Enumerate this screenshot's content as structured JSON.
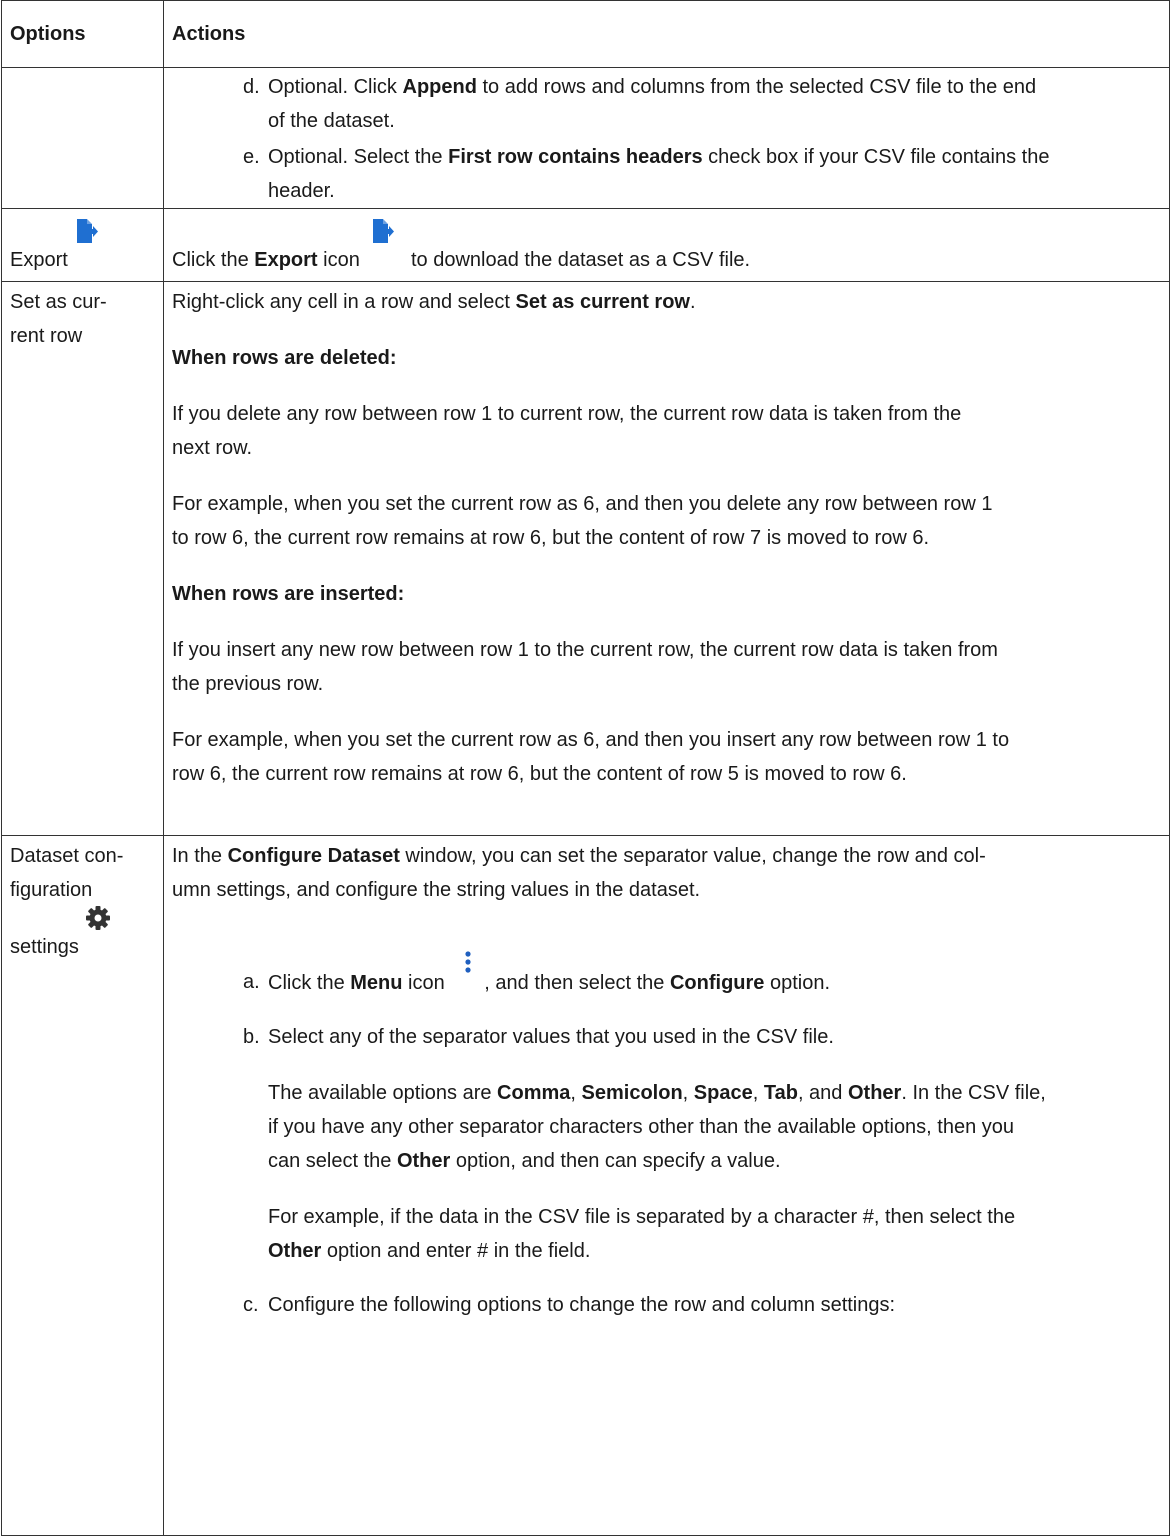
{
  "table": {
    "headers": [
      "Options",
      "Actions"
    ]
  },
  "row_import": {
    "steps": [
      {
        "label": "d.",
        "t1": "Optional. Click ",
        "b1": "Append",
        "line1_rest": " to add rows and columns from the selected CSV file to the end",
        "line2": "of the dataset."
      },
      {
        "label": "e.",
        "t1": "Optional. Select the ",
        "b1": "First row contains headers",
        "line1_rest": " check box if your CSV file contains the",
        "line2": "header."
      }
    ]
  },
  "row_export": {
    "option": "Export",
    "t1": "Click the ",
    "b1": "Export",
    "t2": " icon",
    "t3": "to download the dataset as a CSV file."
  },
  "row_current": {
    "option_line1": "Set as cur-",
    "option_line2": "rent row",
    "p1_text": "Right-click any cell in a row and select ",
    "p1_bold": "Set as current row",
    "p1_end": ".",
    "h1": "When rows are deleted:",
    "p2_l1": "If you delete any row between row 1 to current row, the current row data is taken from the",
    "p2_l2": "next row.",
    "p3_l1": "For example, when you set the current row as 6, and then you delete any row between row 1",
    "p3_l2": "to row 6, the current row remains at row 6, but the content of row 7 is moved to row 6.",
    "h2": "When rows are inserted:",
    "p4_l1": "If you insert any new row between row 1 to the current row, the current row data is taken from",
    "p4_l2": "the previous row.",
    "p5_l1": "For example, when you set the current row as 6, and then you insert any row between row 1 to",
    "p5_l2": "row 6, the current row remains at row 6, but the content of row 5 is moved to row 6."
  },
  "row_config": {
    "option_line1": "Dataset con-",
    "option_line2": "figuration",
    "option_line3": "settings",
    "intro_t1": "In the ",
    "intro_b1": "Configure Dataset",
    "intro_l1_rest": " window, you can set the separator value, change the row and col-",
    "intro_l2": "umn settings, and configure the string values in the dataset.",
    "step_a": {
      "label": "a.",
      "t1": "Click the ",
      "b1": "Menu",
      "t2": " icon",
      "t3": ", and then select the ",
      "b2": "Configure",
      "t4": " option."
    },
    "step_b": {
      "label": "b.",
      "text": "Select any of the separator values that you used in the CSV file.",
      "p1_t1": "The available options are ",
      "p1_b1": "Comma",
      "p1_s1": ", ",
      "p1_b2": "Semicolon",
      "p1_s2": ", ",
      "p1_b3": "Space",
      "p1_s3": ", ",
      "p1_b4": "Tab",
      "p1_s4": ", and ",
      "p1_b5": "Other",
      "p1_l1_end": ". In the CSV file,",
      "p1_l2": "if you have any other separator characters other than the available options, then you",
      "p1_l3_t1": "can select the ",
      "p1_l3_b1": "Other",
      "p1_l3_t2": " option, and then can specify a value.",
      "p2_l1": "For example, if the data in the CSV file is separated by a character #, then select the",
      "p2_l2_b1": "Other",
      "p2_l2_t1": " option and enter # in the field."
    },
    "step_c": {
      "label": "c.",
      "text": "Configure the following options to change the row and column settings:"
    }
  },
  "icons": {
    "export_icon_color": "#1f6fd1",
    "gear_icon_color": "#333333",
    "menu_icon_color": "#1f5fbf"
  }
}
